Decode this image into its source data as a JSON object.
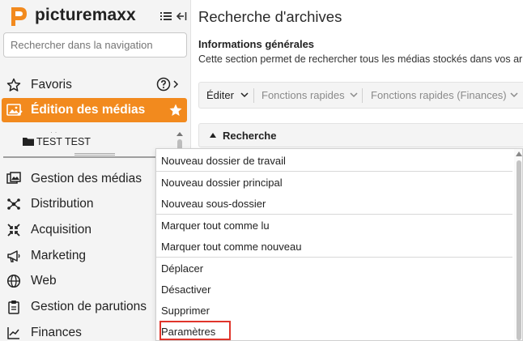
{
  "app": {
    "logo_text": "picturemaxx"
  },
  "sidebar": {
    "search_placeholder": "Rechercher dans la navigation",
    "favoris": {
      "label": "Favoris"
    },
    "active_item": {
      "label": "Édition des médias",
      "color": "#f28a1e"
    },
    "tree": {
      "folder_label": "TEST TEST"
    },
    "items": [
      {
        "label": "Gestion des médias",
        "icon": "media-management-icon"
      },
      {
        "label": "Distribution",
        "icon": "distribution-icon"
      },
      {
        "label": "Acquisition",
        "icon": "acquisition-icon"
      },
      {
        "label": "Marketing",
        "icon": "megaphone-icon"
      },
      {
        "label": "Web",
        "icon": "globe-icon"
      },
      {
        "label": "Gestion de parutions",
        "icon": "clipboard-icon"
      },
      {
        "label": "Finances",
        "icon": "chart-icon"
      }
    ]
  },
  "main": {
    "title": "Recherche d'archives",
    "section_title": "Informations générales",
    "section_desc": "Cette section permet de rechercher tous les médias stockés dans vos ar",
    "toolbar": {
      "editer": "Éditer",
      "fonctions_rapides": "Fonctions rapides",
      "fonctions_rapides_finances": "Fonctions rapides (Finances)"
    },
    "recherche_label": "Recherche"
  },
  "context_menu": {
    "items": [
      "Nouveau dossier de travail",
      "Nouveau dossier principal",
      "Nouveau sous-dossier",
      "Marquer tout comme lu",
      "Marquer tout comme nouveau",
      "Déplacer",
      "Désactiver",
      "Supprimer",
      "Paramètres"
    ],
    "highlight_color": "#e0352b"
  }
}
